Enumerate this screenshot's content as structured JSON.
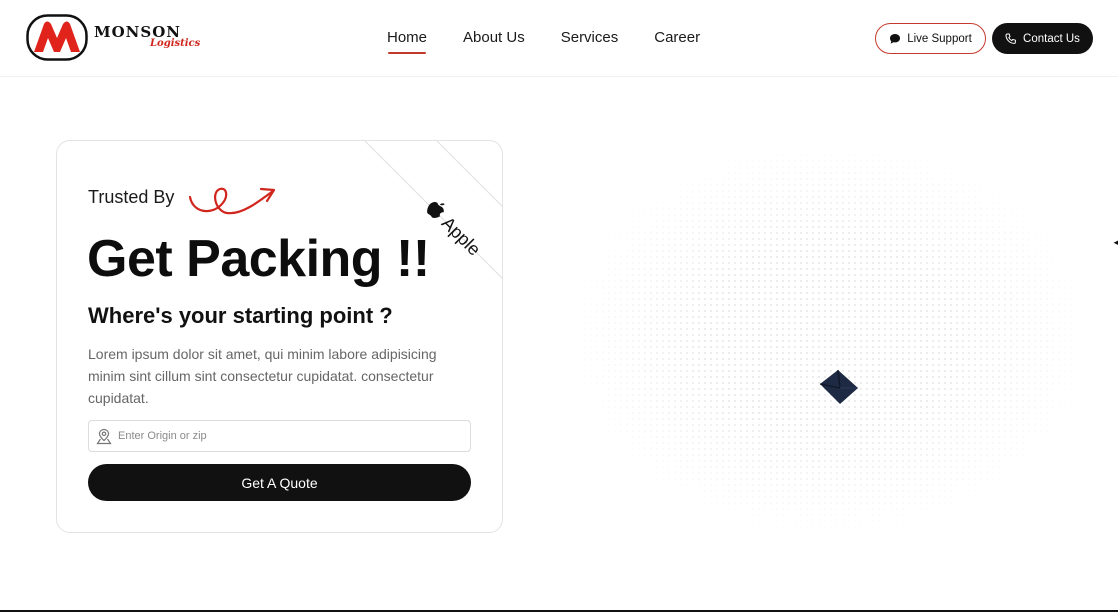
{
  "brand": {
    "name": "MONSON",
    "tagline": "Logistics",
    "accent_color": "#d1261d"
  },
  "nav": {
    "items": [
      {
        "label": "Home",
        "active": true
      },
      {
        "label": "About Us",
        "active": false
      },
      {
        "label": "Services",
        "active": false
      },
      {
        "label": "Career",
        "active": false
      }
    ]
  },
  "header_buttons": {
    "live_support": {
      "label": "Live Support",
      "icon": "chat-bubble-icon"
    },
    "contact": {
      "label": "Contact Us",
      "icon": "phone-icon"
    }
  },
  "hero": {
    "trusted_by": "Trusted By",
    "ribbon_label": "Apple",
    "ribbon_icon": "apple-icon",
    "headline": "Get Packing !!",
    "subheadline": "Where's your starting point ?",
    "description": "Lorem ipsum dolor sit amet, qui minim labore adipisicing minim sint cillum sint consectetur cupidatat. consectetur cupidatat.",
    "origin_input": {
      "placeholder": "Enter Origin or zip",
      "value": "",
      "icon": "location-pin-icon"
    },
    "cta_label": "Get A Quote"
  },
  "colors": {
    "primary_dark": "#111111",
    "accent_red": "#c53a2c",
    "envelope": "#1e2a44"
  }
}
